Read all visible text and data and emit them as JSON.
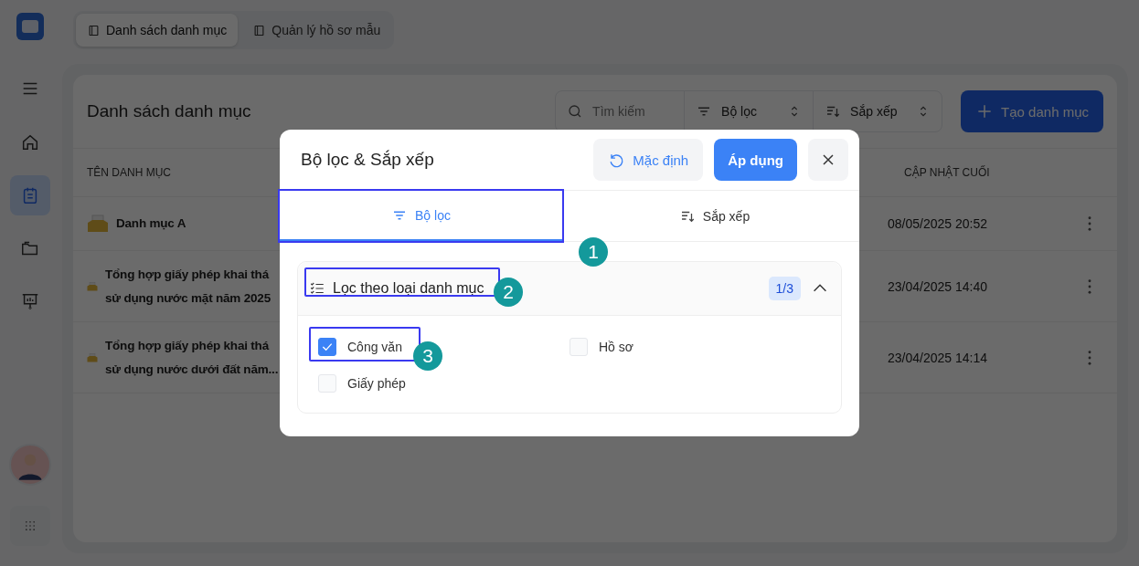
{
  "sidebar": {
    "items": [
      {
        "kind": "home",
        "selected": false
      },
      {
        "kind": "notepad",
        "selected": true
      },
      {
        "kind": "folder",
        "selected": false
      },
      {
        "kind": "presentation",
        "selected": false
      }
    ]
  },
  "top_tabs": [
    {
      "label": "Danh sách danh mục",
      "selected": true
    },
    {
      "label": "Quản lý hồ sơ mẫu",
      "selected": false
    }
  ],
  "card": {
    "title": "Danh sách danh mục",
    "search": {
      "placeholder": "Tìm kiếm"
    },
    "filter": "Bộ lọc",
    "sort": "Sắp xếp",
    "create_button": "Tạo danh mục"
  },
  "table": {
    "columns": [
      "TÊN DANH MỤC",
      "CẬP NHẬT CUỐI"
    ],
    "rows": [
      {
        "name_lines": [
          "Danh mục A"
        ],
        "updated": "08/05/2025 20:52"
      },
      {
        "name_lines": [
          "Tổng hợp giấy phép khai thá",
          "sử dụng nước mặt năm 2025"
        ],
        "updated": "23/04/2025 14:40"
      },
      {
        "name_lines": [
          "Tổng hợp giấy phép khai thá",
          "sử dụng nước dưới đất năm..."
        ],
        "updated": "23/04/2025 14:14"
      }
    ]
  },
  "dialog": {
    "title": "Bộ lọc & Sắp xếp",
    "reset_button": "Mặc định",
    "apply_button": "Áp dụng",
    "tabs": [
      {
        "label": "Bộ lọc",
        "selected": true
      },
      {
        "label": "Sắp xếp",
        "selected": false
      }
    ],
    "section": {
      "title": "Lọc theo loại danh mục",
      "count": "1/3",
      "expanded": true,
      "options": [
        {
          "label": "Công văn",
          "checked": true
        },
        {
          "label": "Hồ sơ",
          "checked": false
        },
        {
          "label": "Giấy phép",
          "checked": false
        }
      ]
    }
  },
  "callouts": [
    "1",
    "2",
    "3"
  ]
}
